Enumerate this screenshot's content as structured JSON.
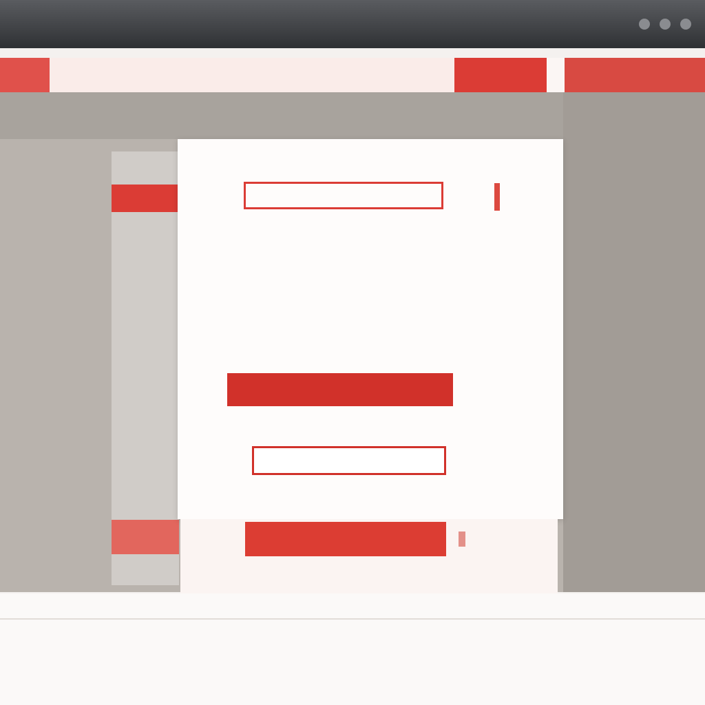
{
  "window": {
    "title": ""
  },
  "tabs": [
    {
      "label": ""
    },
    {
      "label": ""
    },
    {
      "label": ""
    },
    {
      "label": ""
    }
  ],
  "sidebar": {
    "items": [
      {
        "label": ""
      },
      {
        "label": ""
      },
      {
        "label": ""
      }
    ],
    "footer_label": ""
  },
  "dialog": {
    "top_left": "",
    "top_right": "",
    "heading": "",
    "lines": [
      "",
      "",
      "",
      "",
      ""
    ],
    "primary_button": "",
    "secondary_button": "",
    "footnote": ""
  },
  "bottom": {
    "action_button": "",
    "footer_text": ""
  },
  "status": {
    "text": ""
  },
  "colors": {
    "accent": "#d1312a",
    "chrome": "#2f3134",
    "panel": "#b9b3ad"
  }
}
